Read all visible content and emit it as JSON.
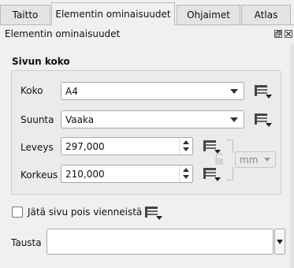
{
  "tabs": [
    {
      "label": "Taitto",
      "active": false
    },
    {
      "label": "Elementin ominaisuudet",
      "active": true
    },
    {
      "label": "Ohjaimet",
      "active": false
    },
    {
      "label": "Atlas",
      "active": false
    }
  ],
  "panel": {
    "title": "Elementin ominaisuudet",
    "float_icon": "float-icon",
    "close_icon": "close-icon"
  },
  "page_size": {
    "section_title": "Sivun koko",
    "size_label": "Koko",
    "size_value": "A4",
    "orientation_label": "Suunta",
    "orientation_value": "Vaaka",
    "width_label": "Leveys",
    "width_value": "297,000",
    "height_label": "Korkeus",
    "height_value": "210,000",
    "units_value": "mm",
    "units_enabled": false,
    "lock_icon": "lock-icon",
    "override_icon": "data-defined-override-icon"
  },
  "exclude": {
    "label": "Jätä sivu pois vienneistä",
    "checked": false
  },
  "background": {
    "label": "Tausta",
    "value": ""
  },
  "colors": {
    "background": "#f0f0f0",
    "group_bg": "#ebebeb",
    "border": "#a8a8a8"
  }
}
